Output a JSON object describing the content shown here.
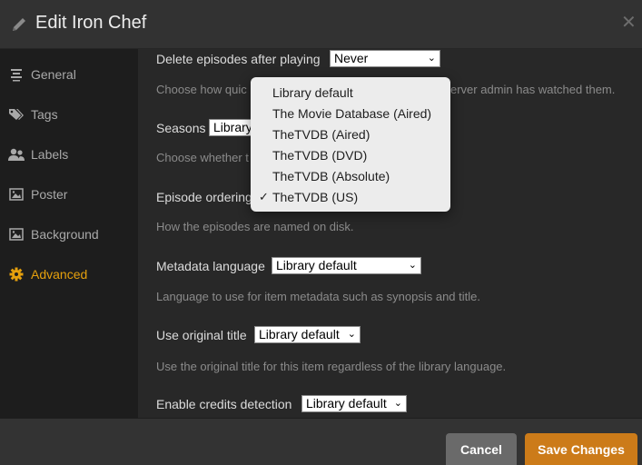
{
  "header": {
    "title": "Edit Iron Chef",
    "icon": "pencil-icon",
    "close_icon": "close-icon",
    "close_glyph": "✕"
  },
  "sidebar": {
    "items": [
      {
        "label": "General",
        "icon": "list-icon",
        "active": false
      },
      {
        "label": "Tags",
        "icon": "tag-icon",
        "active": false
      },
      {
        "label": "Labels",
        "icon": "users-icon",
        "active": false
      },
      {
        "label": "Poster",
        "icon": "image-icon",
        "active": false
      },
      {
        "label": "Background",
        "icon": "image-icon",
        "active": false
      },
      {
        "label": "Advanced",
        "icon": "gear-icon",
        "active": true
      }
    ],
    "accent_color": "#e5a00d"
  },
  "main": {
    "settings": [
      {
        "label": "Delete episodes after playing",
        "value": "Never",
        "description": "Choose how quic… erver admin has watched them.",
        "description_left": "Choose how quic",
        "description_right": "erver admin has watched them."
      },
      {
        "label": "Seasons",
        "value": "Library",
        "description": "Choose whether t"
      },
      {
        "label": "Episode ordering",
        "value": "TheTVDB (US)",
        "description": "How the episodes are named on disk."
      },
      {
        "label": "Metadata language",
        "value": "Library default",
        "description": "Language to use for item metadata such as synopsis and title."
      },
      {
        "label": "Use original title",
        "value": "Library default",
        "description": "Use the original title for this item regardless of the library language."
      },
      {
        "label": "Enable credits detection",
        "value": "Library default"
      }
    ],
    "chevron_glyph": "⌄"
  },
  "dropdown": {
    "options": [
      {
        "label": "Library default",
        "selected": false
      },
      {
        "label": "The Movie Database (Aired)",
        "selected": false
      },
      {
        "label": "TheTVDB (Aired)",
        "selected": false
      },
      {
        "label": "TheTVDB (DVD)",
        "selected": false
      },
      {
        "label": "TheTVDB (Absolute)",
        "selected": false
      },
      {
        "label": "TheTVDB (US)",
        "selected": true
      }
    ],
    "check_glyph": "✓"
  },
  "footer": {
    "cancel_label": "Cancel",
    "save_label": "Save Changes",
    "save_color": "#cc7b19"
  }
}
